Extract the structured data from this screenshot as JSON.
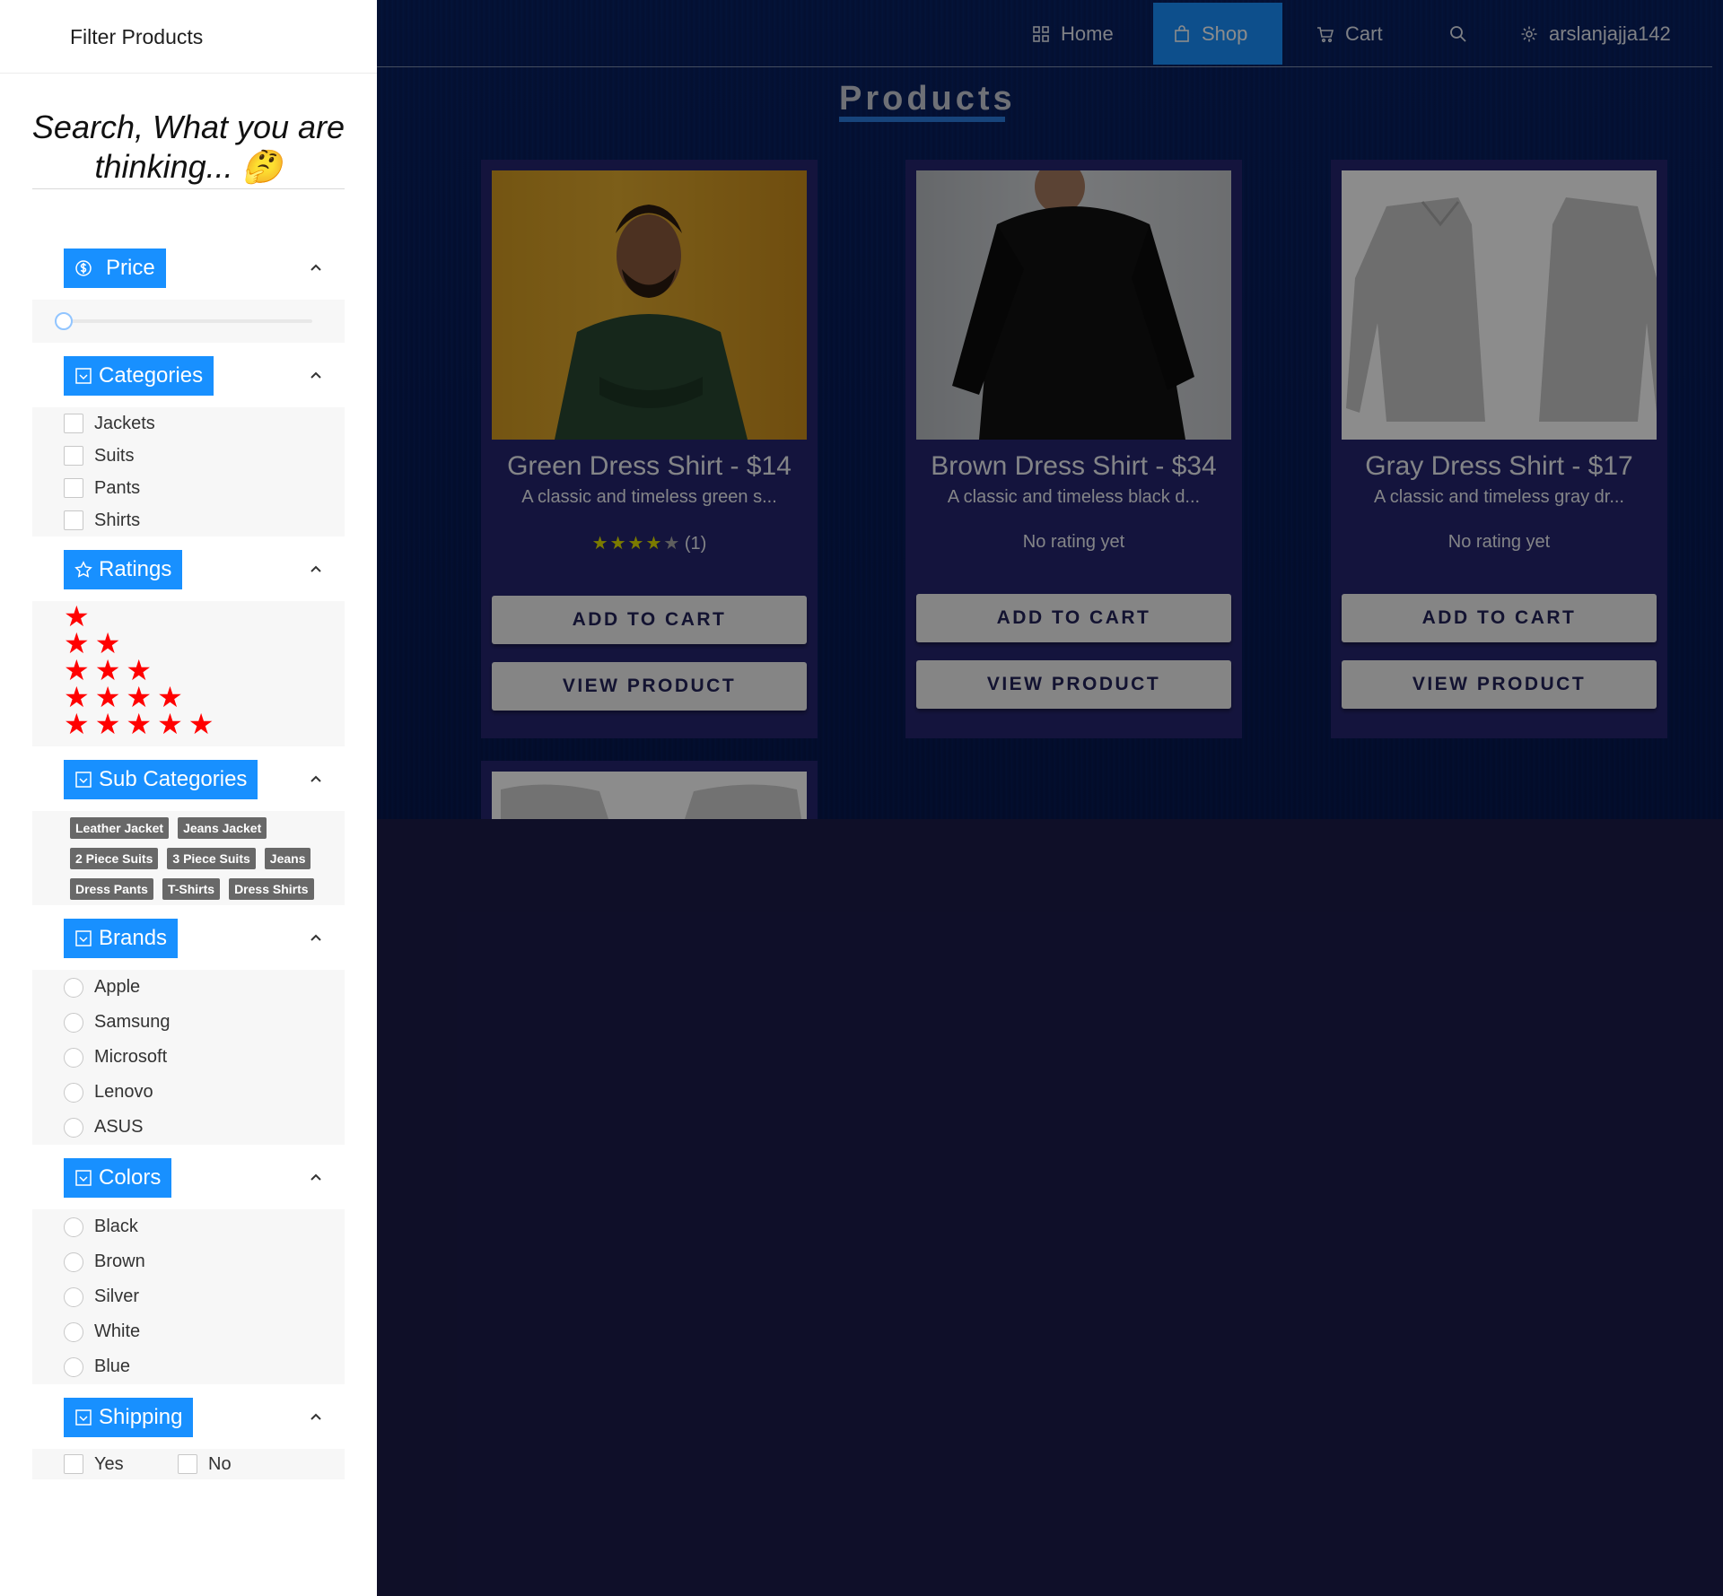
{
  "nav": {
    "home": "Home",
    "shop": "Shop",
    "cart": "Cart",
    "user": "arslanjajja142"
  },
  "main": {
    "products_title": "Products",
    "products": [
      {
        "title": "Green Dress Shirt - $14",
        "description": "A classic and timeless green s...",
        "rating_count": "(1)",
        "rating_value": 4,
        "add_to_cart": "ADD TO CART",
        "view": "VIEW PRODUCT"
      },
      {
        "title": "Brown Dress Shirt - $34",
        "description": "A classic and timeless black d...",
        "rating_text": "No rating yet",
        "add_to_cart": "ADD TO CART",
        "view": "VIEW PRODUCT"
      },
      {
        "title": "Gray Dress Shirt - $17",
        "description": "A classic and timeless gray dr...",
        "rating_text": "No rating yet",
        "add_to_cart": "ADD TO CART",
        "view": "VIEW PRODUCT"
      }
    ]
  },
  "drawer": {
    "title": "Filter Products",
    "search_heading": "Search, What you are thinking... 🤔",
    "sections": {
      "price": "Price",
      "categories": "Categories",
      "ratings": "Ratings",
      "sub_categories": "Sub Categories",
      "brands": "Brands",
      "colors": "Colors",
      "shipping": "Shipping"
    },
    "price_slider_value": 0,
    "categories": [
      "Jackets",
      "Suits",
      "Pants",
      "Shirts"
    ],
    "ratings": [
      1,
      2,
      3,
      4,
      5
    ],
    "sub_categories": [
      "Leather Jacket",
      "Jeans Jacket",
      "2 Piece Suits",
      "3 Piece Suits",
      "Jeans",
      "Dress Pants",
      "T-Shirts",
      "Dress Shirts"
    ],
    "brands": [
      "Apple",
      "Samsung",
      "Microsoft",
      "Lenovo",
      "ASUS"
    ],
    "colors": [
      "Black",
      "Brown",
      "Silver",
      "White",
      "Blue"
    ],
    "shipping": [
      "Yes",
      "No"
    ]
  },
  "colors": {
    "accent": "#1890ff",
    "star_red": "#ff0000",
    "card_bg": "#262670",
    "page_bg": "#1c1c4a"
  }
}
